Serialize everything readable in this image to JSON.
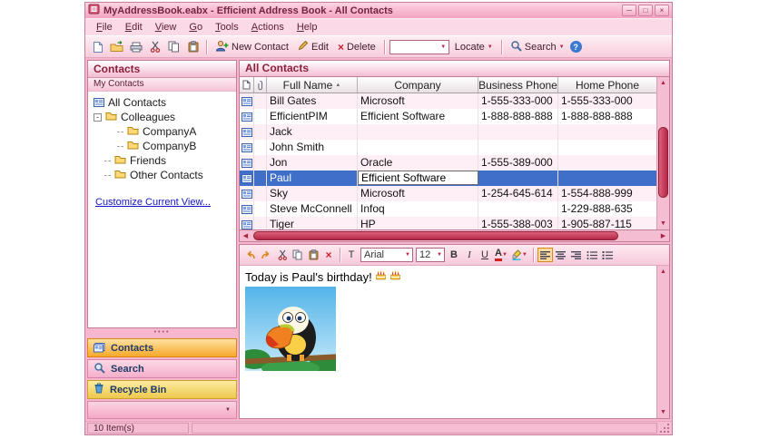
{
  "window": {
    "title": "MyAddressBook.eabx - Efficient Address Book - All Contacts",
    "status": "10 Item(s)"
  },
  "menubar": {
    "items": [
      {
        "label": "File"
      },
      {
        "label": "Edit"
      },
      {
        "label": "View"
      },
      {
        "label": "Go"
      },
      {
        "label": "Tools"
      },
      {
        "label": "Actions"
      },
      {
        "label": "Help"
      }
    ]
  },
  "toolbar": {
    "new_contact_label": "New Contact",
    "edit_label": "Edit",
    "delete_label": "Delete",
    "locate_label": "Locate",
    "search_label": "Search",
    "quick_search_value": ""
  },
  "sidebar": {
    "header": "Contacts",
    "group_label": "My Contacts",
    "tree": {
      "all_contacts": "All Contacts",
      "colleagues": "Colleagues",
      "company_a": "CompanyA",
      "company_b": "CompanyB",
      "friends": "Friends",
      "other_contacts": "Other Contacts"
    },
    "customize_link": "Customize Current View...",
    "nav": {
      "contacts": "Contacts",
      "search": "Search",
      "recycle_bin": "Recycle Bin"
    }
  },
  "main": {
    "view_title": "All Contacts",
    "columns": {
      "full_name": "Full Name",
      "company": "Company",
      "business_phone": "Business Phone",
      "home_phone": "Home Phone"
    },
    "rows": [
      {
        "full_name": "Bill Gates",
        "company": "Microsoft",
        "business_phone": "1-555-333-000",
        "home_phone": "1-555-333-000",
        "selected": false
      },
      {
        "full_name": "EfficientPIM",
        "company": "Efficient Software",
        "business_phone": "1-888-888-888",
        "home_phone": "1-888-888-888",
        "selected": false
      },
      {
        "full_name": "Jack",
        "company": "",
        "business_phone": "",
        "home_phone": "",
        "selected": false
      },
      {
        "full_name": "John Smith",
        "company": "",
        "business_phone": "",
        "home_phone": "",
        "selected": false
      },
      {
        "full_name": "Jon",
        "company": "Oracle",
        "business_phone": "1-555-389-000",
        "home_phone": "",
        "selected": false
      },
      {
        "full_name": "Paul",
        "company": "Efficient Software",
        "business_phone": "",
        "home_phone": "",
        "selected": true
      },
      {
        "full_name": "Sky",
        "company": "Microsoft",
        "business_phone": "1-254-645-614",
        "home_phone": "1-554-888-999",
        "selected": false
      },
      {
        "full_name": "Steve McConnell",
        "company": "Infoq",
        "business_phone": "",
        "home_phone": "1-229-888-635",
        "selected": false
      },
      {
        "full_name": "Tiger",
        "company": "HP",
        "business_phone": "1-555-388-003",
        "home_phone": "1-905-887-115",
        "selected": false
      }
    ]
  },
  "editor": {
    "font_name": "Arial",
    "font_size": "12",
    "note_text": "Today is Paul's birthday!",
    "bold_label": "B",
    "italic_label": "I",
    "underline_label": "U",
    "font_color_label": "A",
    "font_icon_label": "T"
  },
  "icons": {
    "minimize": "─",
    "maximize": "□",
    "close": "×",
    "delete_x": "×",
    "dropdown_arrow": "▼",
    "sort_asc": "▲",
    "up_arrow": "▲",
    "down_arrow": "▼",
    "left_arrow": "◀",
    "right_arrow": "▶",
    "help": "?",
    "expand_minus": "-",
    "splitter_dots": "••••",
    "collapse_chevron": "▼"
  },
  "colors": {
    "selection_blue": "#3f6fc8",
    "scrollbar_red": "#b52747",
    "titlebar_pink": "#f5a3c2",
    "nav_active_orange": "#f7a82a"
  }
}
